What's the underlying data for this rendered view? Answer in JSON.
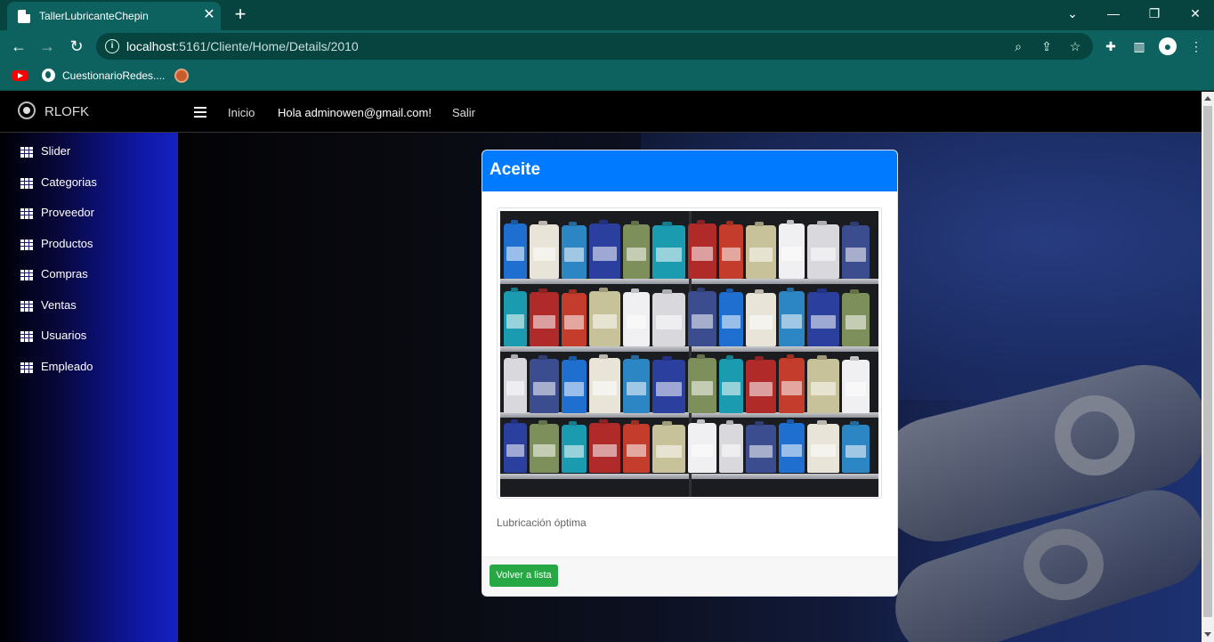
{
  "browser": {
    "tab_title": "TallerLubricanteChepin",
    "url_host": "localhost",
    "url_path": ":5161/Cliente/Home/Details/2010",
    "bookmark_label": "CuestionarioRedes...."
  },
  "navbar": {
    "brand": "RLOFK",
    "links": {
      "home": "Inicio",
      "greeting": "Hola adminowen@gmail.com!",
      "logout": "Salir"
    }
  },
  "sidebar": {
    "items": [
      {
        "label": "Slider"
      },
      {
        "label": "Categorias"
      },
      {
        "label": "Proveedor"
      },
      {
        "label": "Productos"
      },
      {
        "label": "Compras"
      },
      {
        "label": "Ventas"
      },
      {
        "label": "Usuarios"
      },
      {
        "label": "Empleado"
      }
    ]
  },
  "product": {
    "title": "Aceite",
    "image_alt": "oil-bottles-shelf-photo",
    "description": "Lubricación óptima",
    "back_button": "Volver a lista"
  },
  "colors": {
    "browser_frame": "#0d6260",
    "card_header": "#007bff",
    "back_button": "#28a745",
    "sidebar_gradient_end": "#1522c0"
  }
}
